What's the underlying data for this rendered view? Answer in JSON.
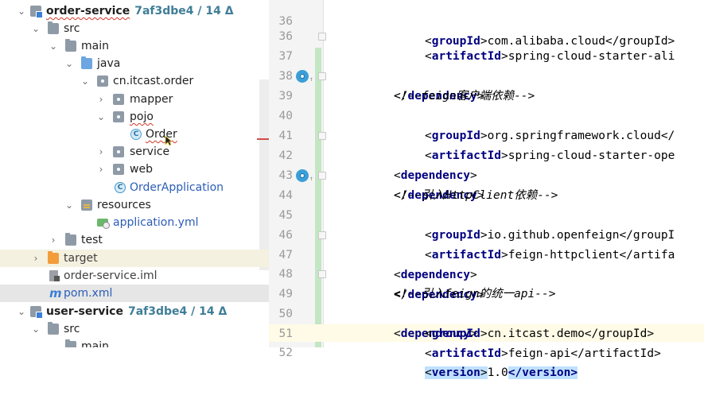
{
  "project_tree": {
    "rows": [
      {
        "label": "order-service",
        "meta": "7af3dbe4 / 14 Δ"
      },
      {
        "label": "src"
      },
      {
        "label": "main"
      },
      {
        "label": "java"
      },
      {
        "label": "cn.itcast.order"
      },
      {
        "label": "mapper"
      },
      {
        "label": "pojo"
      },
      {
        "label": "Order"
      },
      {
        "label": "service"
      },
      {
        "label": "web"
      },
      {
        "label": "OrderApplication"
      },
      {
        "label": "resources"
      },
      {
        "label": "application.yml"
      },
      {
        "label": "test"
      },
      {
        "label": "target"
      },
      {
        "label": "order-service.iml"
      },
      {
        "label": "pom.xml"
      },
      {
        "label": "user-service",
        "meta": "7af3dbe4 / 14 Δ"
      },
      {
        "label": "src"
      },
      {
        "label": "main"
      }
    ]
  },
  "editor": {
    "lines": [
      {
        "num": "36",
        "indent": "    ",
        "tag": "groupId",
        "value": "com.alibaba.cloud</groupId>"
      },
      {
        "num": "36",
        "indent": "    ",
        "tag": "artifactId",
        "value": "spring-cloud-starter-ali"
      },
      {
        "num": "37",
        "close_tag": "dependency"
      },
      {
        "num": "38",
        "comment": "<!--feign客户端依赖-->"
      },
      {
        "num": "39",
        "open_tag": "dependency"
      },
      {
        "num": "40",
        "indent": "    ",
        "tag": "groupId",
        "value": "org.springframework.cloud</"
      },
      {
        "num": "41",
        "indent": "    ",
        "tag": "artifactId",
        "value": "spring-cloud-starter-ope"
      },
      {
        "num": "42",
        "close_tag": "dependency"
      },
      {
        "num": "43",
        "comment": "<!--引入HttpClient依赖-->"
      },
      {
        "num": "44",
        "open_tag": "dependency"
      },
      {
        "num": "45",
        "indent": "    ",
        "tag": "groupId",
        "value": "io.github.openfeign</groupI"
      },
      {
        "num": "46",
        "indent": "    ",
        "tag": "artifactId",
        "value": "feign-httpclient</artifa"
      },
      {
        "num": "47",
        "close_tag": "dependency"
      },
      {
        "num": "48",
        "comment": "<!--引入feign的统一api-->"
      },
      {
        "num": "49",
        "open_tag": "dependency"
      },
      {
        "num": "50",
        "indent": "    ",
        "tag": "groupId",
        "value": "cn.itcast.demo</groupId>"
      },
      {
        "num": "51",
        "indent": "    ",
        "tag": "artifactId",
        "value": "feign-api</artifactId>"
      },
      {
        "num": "52",
        "indent": "    ",
        "tag": "version",
        "value": "1.0",
        "tag_close": "</version>"
      }
    ]
  },
  "colors": {
    "accent_blue": "#2b5db7",
    "tag_name": "#000080",
    "comment": "#8c8c8c",
    "change_bar": "#c3e6c3"
  }
}
